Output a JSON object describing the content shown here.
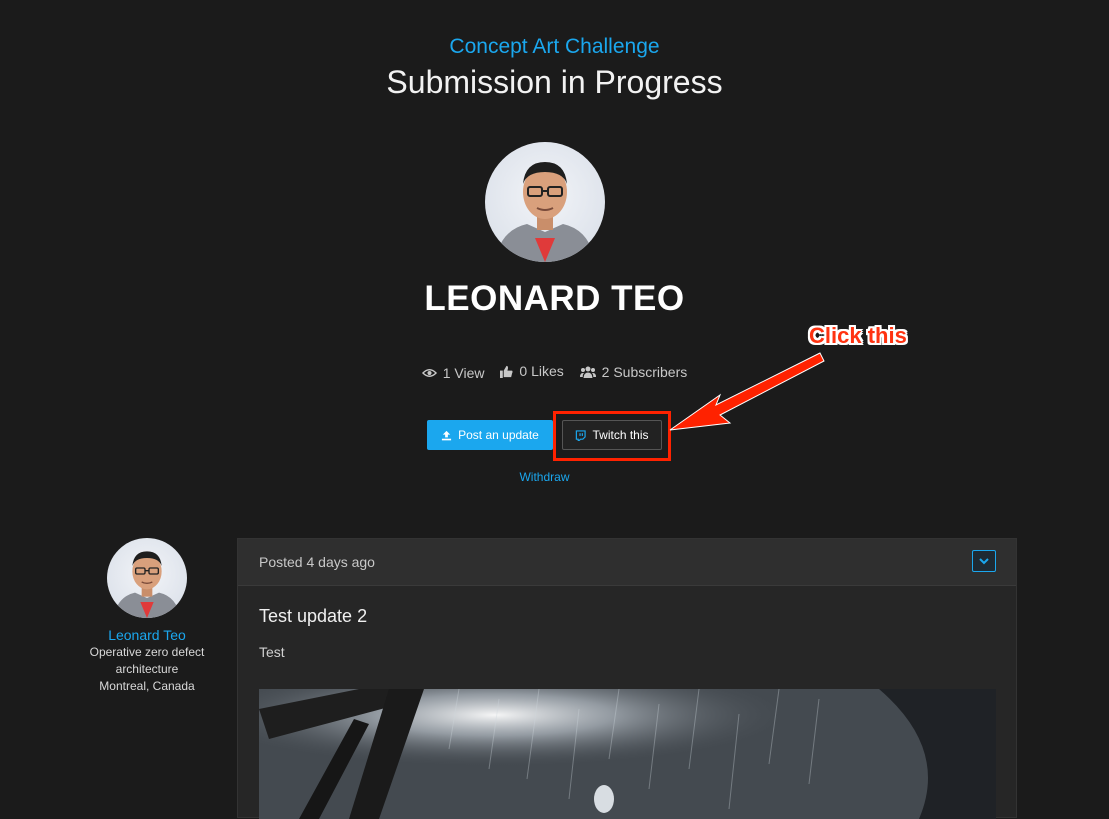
{
  "header": {
    "challenge_label": "Concept Art Challenge",
    "title": "Submission in Progress"
  },
  "profile": {
    "name": "LEONARD TEO",
    "stats": {
      "views": "1 View",
      "likes": "0 Likes",
      "subscribers": "2 Subscribers"
    }
  },
  "actions": {
    "post_update": "Post an update",
    "twitch": "Twitch this",
    "withdraw": "Withdraw"
  },
  "annotation": {
    "text": "Click this",
    "color": "#ff3311"
  },
  "author": {
    "name": "Leonard Teo",
    "title_line1": "Operative zero defect",
    "title_line2": "architecture",
    "location": "Montreal, Canada"
  },
  "post": {
    "posted": "Posted 4 days ago",
    "title": "Test update 2",
    "body": "Test"
  },
  "colors": {
    "accent": "#1ba7ee",
    "background": "#1b1b1b",
    "highlight": "#ff2200"
  }
}
